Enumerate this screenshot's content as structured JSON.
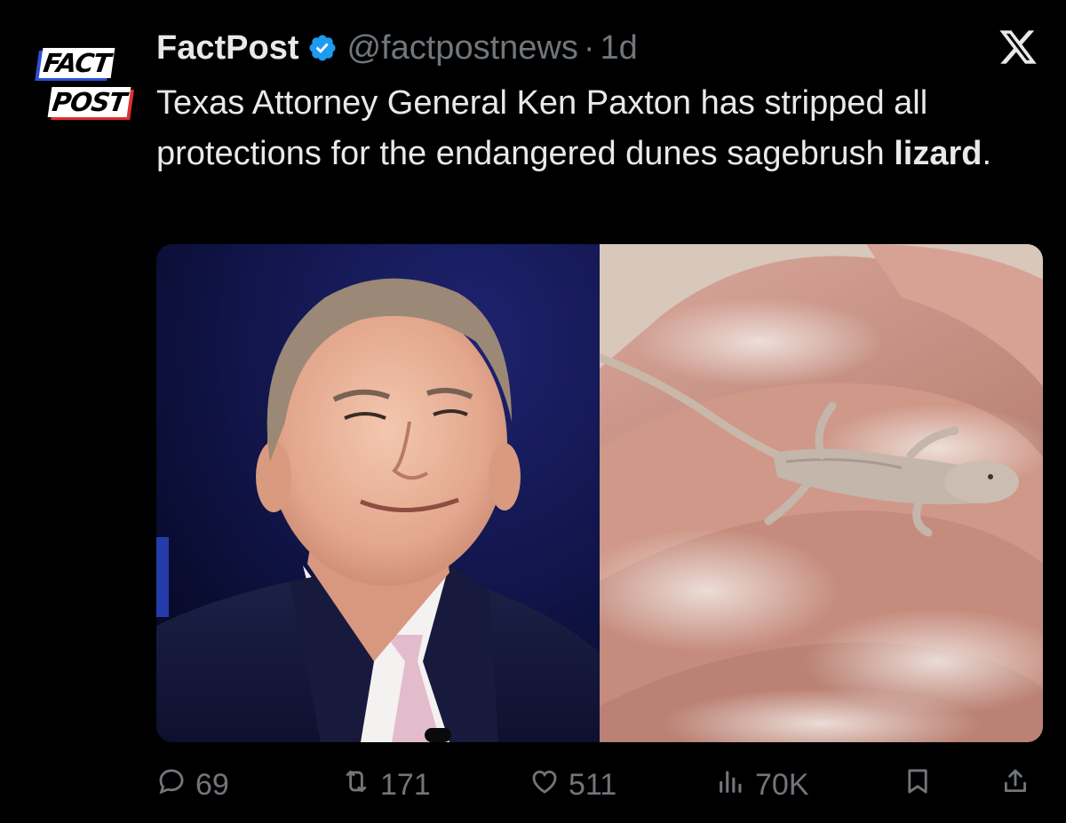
{
  "account": {
    "avatar_text_line1": "FACT",
    "avatar_text_line2": "POST",
    "display_name": "FactPost",
    "verified_icon": "verified-badge-icon",
    "handle": "@factpostnews",
    "separator": "·",
    "time": "1d"
  },
  "platform_icon": "x-logo-icon",
  "tweet": {
    "text_main": "Texas Attorney General Ken Paxton has stripped all protections for the endangered dunes sagebrush ",
    "text_bold": "lizard",
    "text_end": "."
  },
  "media": {
    "left_image": "man-in-suit-photo",
    "right_image": "lizard-in-hand-photo"
  },
  "actions": {
    "replies": "69",
    "reposts": "171",
    "likes": "511",
    "views": "70K"
  },
  "colors": {
    "background": "#000000",
    "primary_text": "#e7e9ea",
    "secondary_text": "#71767b",
    "verified_blue": "#1d9bf0"
  }
}
